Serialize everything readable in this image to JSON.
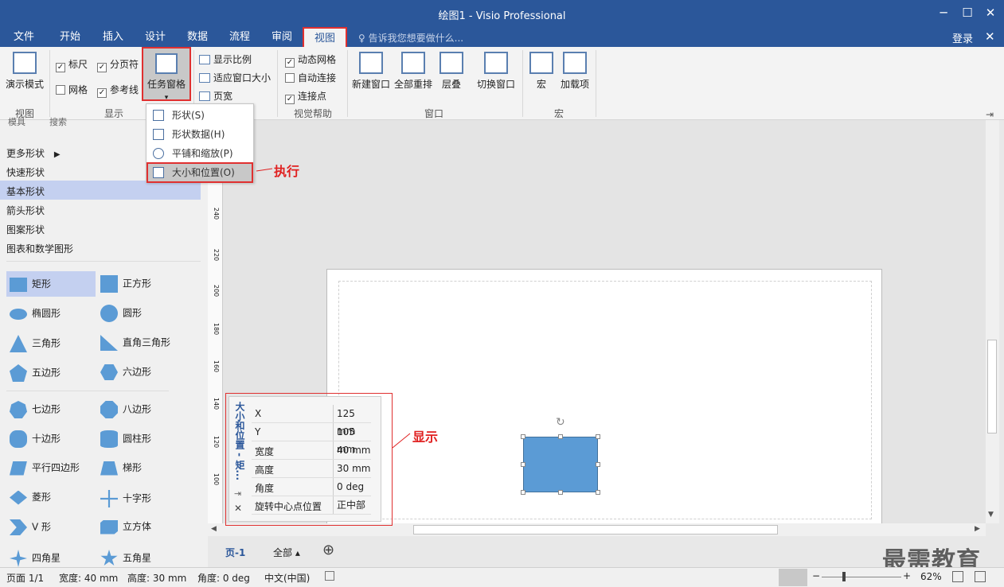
{
  "window": {
    "title": "绘图1 - Visio Professional",
    "min": "─",
    "max": "☐",
    "close": "✕",
    "signin": "登录",
    "ribbon_close": "✕"
  },
  "tabs": [
    "文件",
    "开始",
    "插入",
    "设计",
    "数据",
    "流程",
    "审阅",
    "视图"
  ],
  "active_tab": "视图",
  "tell_me": "告诉我您想要做什么...",
  "ribbon": {
    "presentation": "演示模式",
    "group_view": "视图",
    "ruler": "标尺",
    "page_breaks": "分页符",
    "grid": "网格",
    "guides": "参考线",
    "task_panes": "任务窗格",
    "group_show": "显示",
    "zoom": "显示比例",
    "fit_window": "适应窗口大小",
    "page_width": "页宽",
    "dyn_grid": "动态网格",
    "auto_connect": "自动连接",
    "connection_points": "连接点",
    "group_visual": "视觉帮助",
    "new_window": "新建窗口",
    "arrange_all": "全部重排",
    "cascade": "层叠",
    "switch_windows": "切换窗口",
    "group_window": "窗口",
    "macros": "宏",
    "addins": "加载项",
    "group_macros": "宏"
  },
  "dropdown": [
    "形状(S)",
    "形状数据(H)",
    "平铺和缩放(P)",
    "大小和位置(O)"
  ],
  "annotations": {
    "execute": "执行",
    "display": "显示"
  },
  "left": {
    "tabs": [
      "模具",
      "搜索"
    ],
    "categories": [
      "更多形状",
      "快速形状",
      "基本形状",
      "箭头形状",
      "图案形状",
      "图表和数学图形"
    ],
    "shapes": [
      "矩形",
      "正方形",
      "椭圆形",
      "圆形",
      "三角形",
      "直角三角形",
      "五边形",
      "六边形",
      "七边形",
      "八边形",
      "十边形",
      "圆柱形",
      "平行四边形",
      "梯形",
      "菱形",
      "十字形",
      "V 形",
      "立方体",
      "四角星",
      "五角星"
    ]
  },
  "ruler_labels": [
    "240",
    "220",
    "200",
    "180",
    "160",
    "140",
    "120",
    "100"
  ],
  "size_pane": {
    "title": "大小和位置 - 矩...",
    "rows": [
      {
        "k": "X",
        "v": "125 mm"
      },
      {
        "k": "Y",
        "v": "105 mm"
      },
      {
        "k": "宽度",
        "v": "40 mm"
      },
      {
        "k": "高度",
        "v": "30 mm"
      },
      {
        "k": "角度",
        "v": "0 deg"
      },
      {
        "k": "旋转中心点位置",
        "v": "正中部"
      }
    ]
  },
  "page_tabs": {
    "page": "页-1",
    "all": "全部 ▴",
    "add": "⊕"
  },
  "status": {
    "page": "页面 1/1",
    "width": "宽度: 40 mm",
    "height": "高度: 30 mm",
    "angle": "角度: 0 deg",
    "lang": "中文(中国)",
    "zoom": "62%"
  },
  "watermark": "最需教育",
  "colors": {
    "brand": "#2b579a",
    "shape": "#5b9bd5",
    "highlight": "#e02020"
  }
}
